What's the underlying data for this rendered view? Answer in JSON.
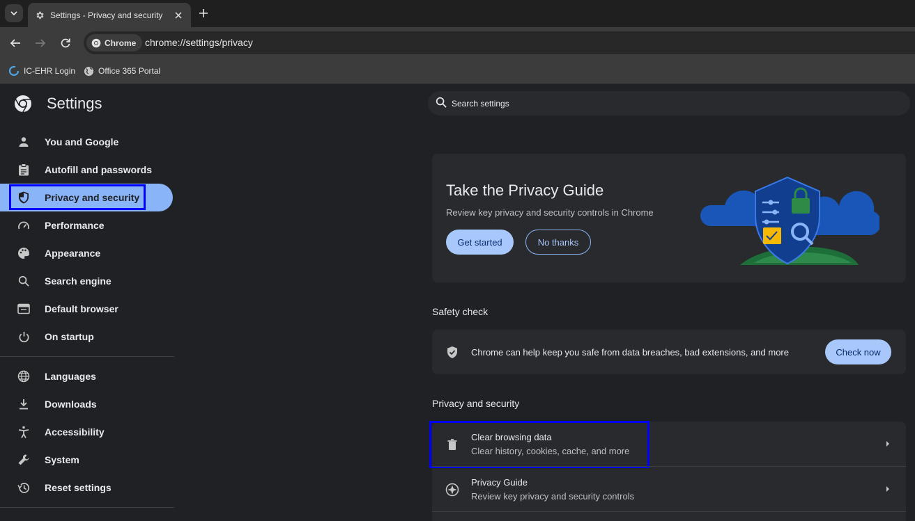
{
  "browser": {
    "tab_title": "Settings - Privacy and security",
    "chip_label": "Chrome",
    "url": "chrome://settings/privacy",
    "bookmarks": [
      "IC-EHR Login",
      "Office 365 Portal"
    ]
  },
  "settings": {
    "title": "Settings",
    "search_placeholder": "Search settings"
  },
  "sidebar": {
    "items": [
      {
        "label": "You and Google",
        "icon": "person-icon"
      },
      {
        "label": "Autofill and passwords",
        "icon": "clipboard-icon"
      },
      {
        "label": "Privacy and security",
        "icon": "shield-icon",
        "active": true
      },
      {
        "label": "Performance",
        "icon": "speedometer-icon"
      },
      {
        "label": "Appearance",
        "icon": "palette-icon"
      },
      {
        "label": "Search engine",
        "icon": "search-icon"
      },
      {
        "label": "Default browser",
        "icon": "browser-window-icon"
      },
      {
        "label": "On startup",
        "icon": "power-icon"
      }
    ],
    "items2": [
      {
        "label": "Languages",
        "icon": "globe-icon"
      },
      {
        "label": "Downloads",
        "icon": "download-icon"
      },
      {
        "label": "Accessibility",
        "icon": "accessibility-icon"
      },
      {
        "label": "System",
        "icon": "wrench-icon"
      },
      {
        "label": "Reset settings",
        "icon": "history-icon"
      }
    ]
  },
  "privacy_guide_card": {
    "title": "Take the Privacy Guide",
    "subtitle": "Review key privacy and security controls in Chrome",
    "primary_button": "Get started",
    "secondary_button": "No thanks"
  },
  "safety_check": {
    "section_title": "Safety check",
    "text": "Chrome can help keep you safe from data breaches, bad extensions, and more",
    "button": "Check now"
  },
  "privacy_section": {
    "title": "Privacy and security",
    "rows": [
      {
        "title": "Clear browsing data",
        "subtitle": "Clear history, cookies, cache, and more",
        "icon": "trash-icon"
      },
      {
        "title": "Privacy Guide",
        "subtitle": "Review key privacy and security controls",
        "icon": "compass-icon"
      }
    ]
  },
  "colors": {
    "accent": "#8ab4f8",
    "highlight_box": "#0000ff",
    "background": "#202124",
    "card": "#292a2d"
  }
}
